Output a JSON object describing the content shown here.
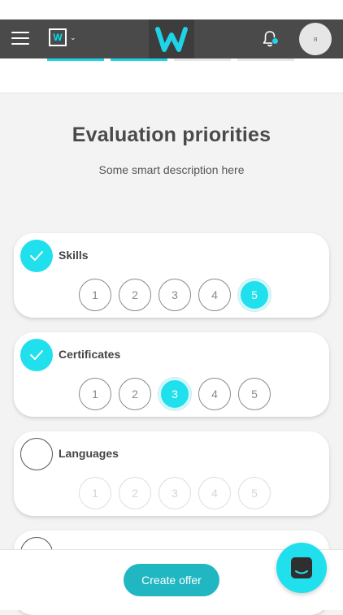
{
  "header": {
    "brand_letter": "W",
    "avatar_initials": "ᴙ",
    "logo_color": "#1fd3e8",
    "notification_color": "#1fd3e8"
  },
  "page": {
    "title": "Evaluation priorities",
    "subtitle": "Some smart description here"
  },
  "criteria": [
    {
      "label": "Skills",
      "checked": true,
      "selected": 5,
      "ratings": [
        "1",
        "2",
        "3",
        "4",
        "5"
      ]
    },
    {
      "label": "Certificates",
      "checked": true,
      "selected": 3,
      "ratings": [
        "1",
        "2",
        "3",
        "4",
        "5"
      ]
    },
    {
      "label": "Languages",
      "checked": false,
      "selected": 0,
      "ratings": [
        "1",
        "2",
        "3",
        "4",
        "5"
      ]
    },
    {
      "label": "",
      "checked": false,
      "selected": 0,
      "ratings": []
    }
  ],
  "footer": {
    "create_label": "Create offer"
  },
  "colors": {
    "accent": "#1fe0ec",
    "button": "#20b6c2",
    "topbar": "#4a4a4a"
  }
}
